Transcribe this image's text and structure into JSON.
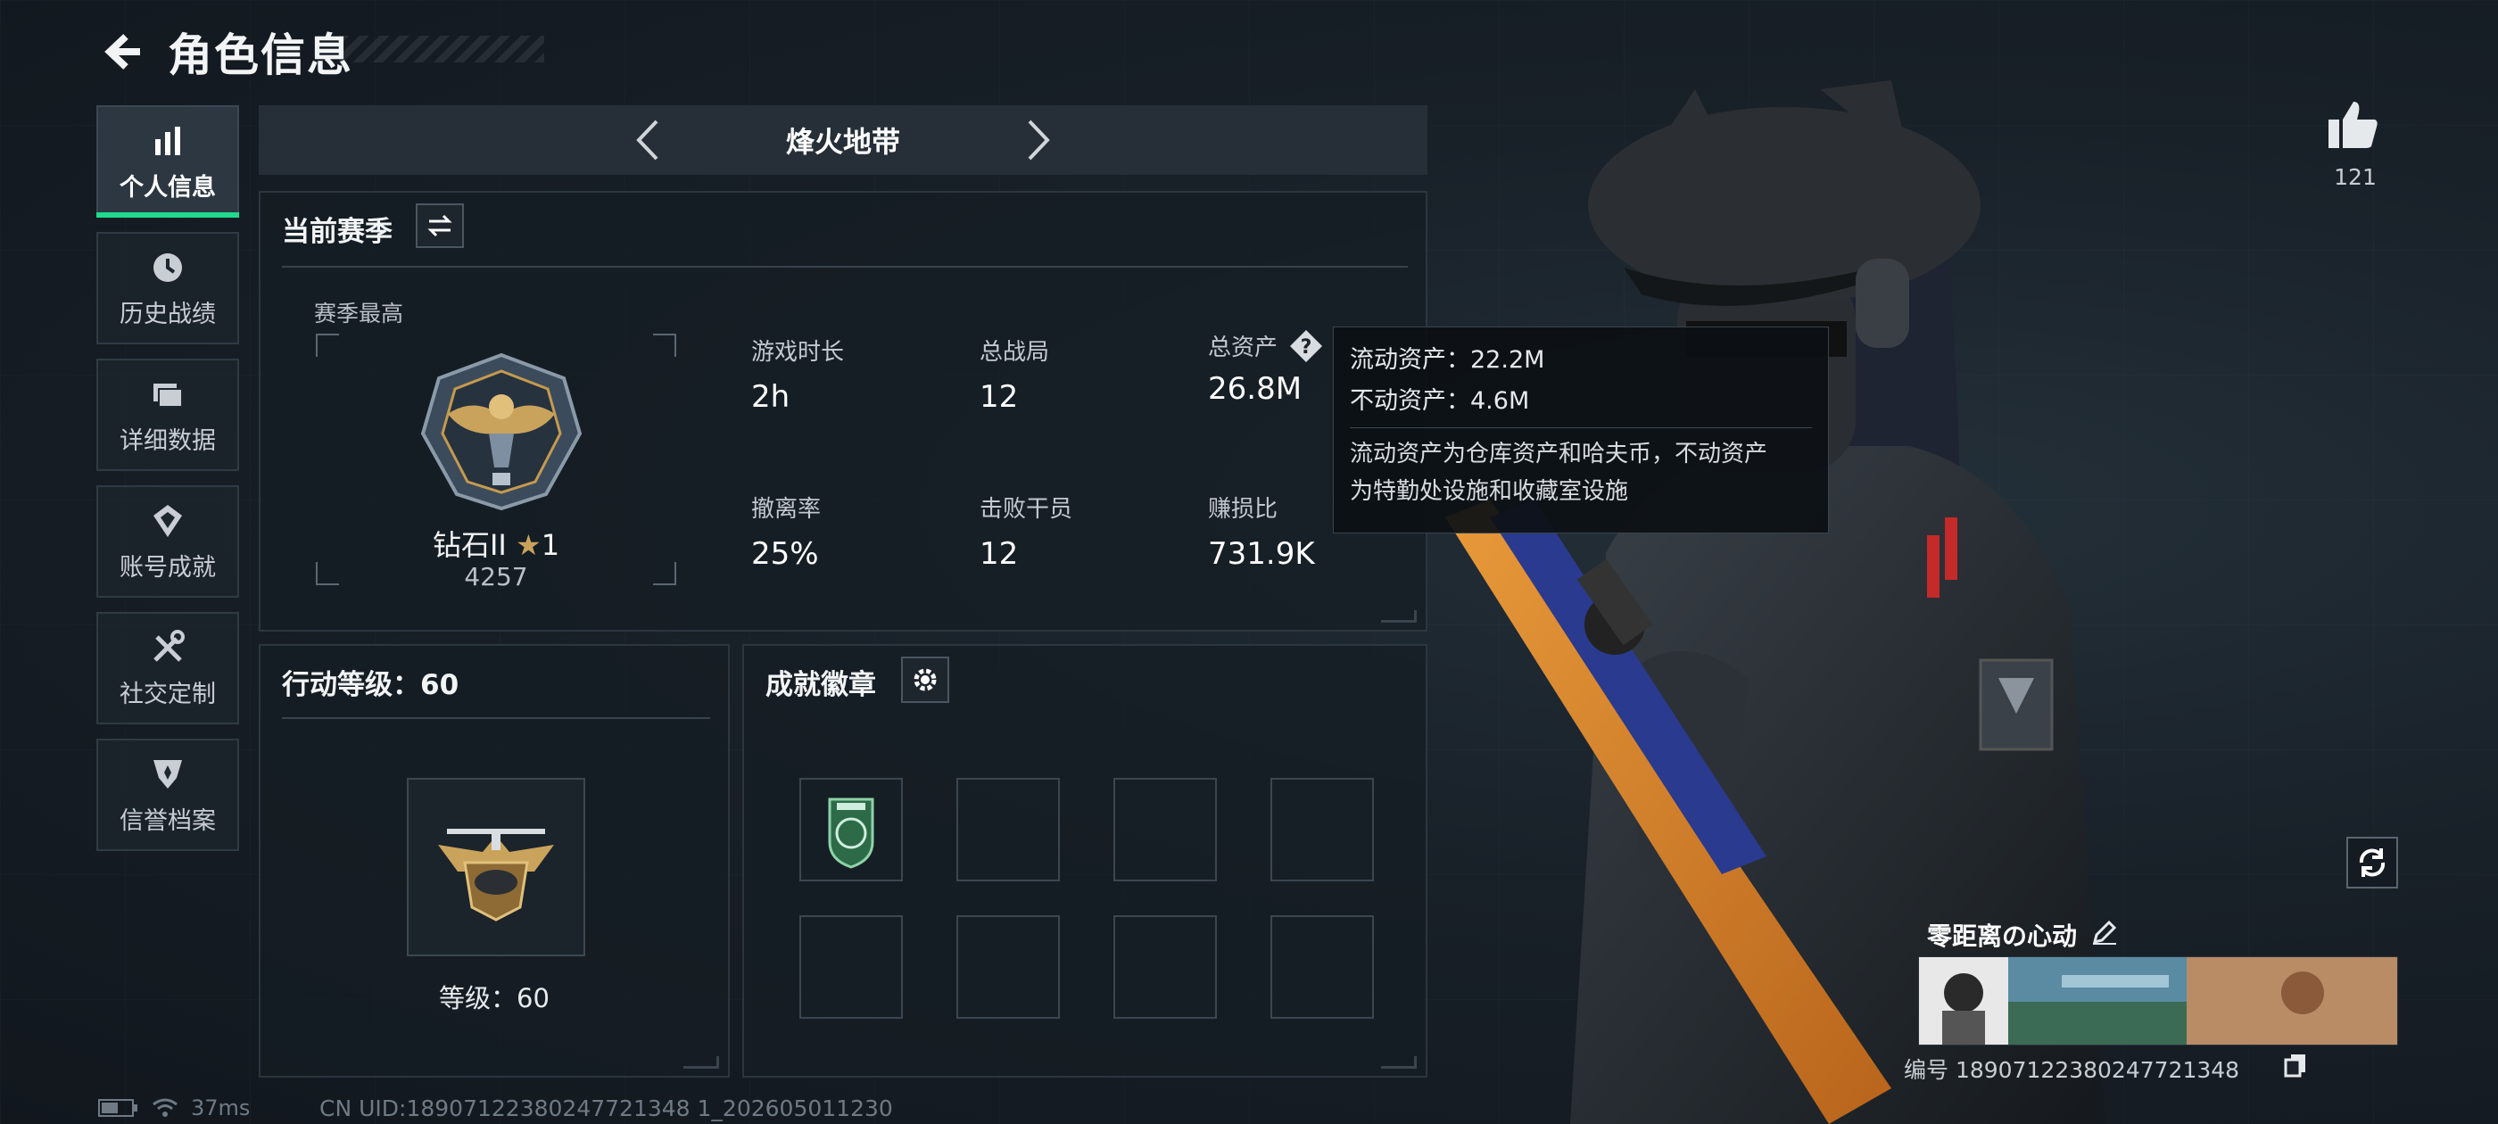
{
  "header": {
    "title": "角色信息"
  },
  "nav": {
    "items": [
      {
        "label": "个人信息",
        "icon": "bar-chart-icon",
        "active": true
      },
      {
        "label": "历史战绩",
        "icon": "clock-icon",
        "active": false
      },
      {
        "label": "详细数据",
        "icon": "folder-icon",
        "active": false
      },
      {
        "label": "账号成就",
        "icon": "achievement-icon",
        "active": false
      },
      {
        "label": "社交定制",
        "icon": "tools-icon",
        "active": false
      },
      {
        "label": "信誉档案",
        "icon": "shield-icon",
        "active": false
      }
    ]
  },
  "mode": {
    "title": "烽火地带"
  },
  "season": {
    "title": "当前赛季",
    "subtitle": "赛季最高",
    "rank_name": "钻石II",
    "rank_stars": "1",
    "rank_score": "4257",
    "stats": [
      {
        "label": "游戏时长",
        "value": "2h"
      },
      {
        "label": "总战局",
        "value": "12"
      },
      {
        "label": "总资产",
        "value": "26.8M"
      },
      {
        "label": "撤离率",
        "value": "25%"
      },
      {
        "label": "击败干员",
        "value": "12"
      },
      {
        "label": "赚损比",
        "value": "731.9K"
      }
    ]
  },
  "tooltip": {
    "liquid": "流动资产：22.2M",
    "fixed": "不动资产：4.6M",
    "desc_line1": "流动资产为仓库资产和哈夫币，不动资产",
    "desc_line2": "为特勤处设施和收藏室设施"
  },
  "level": {
    "title": "行动等级：60",
    "label": "等级：60"
  },
  "badges": {
    "title": "成就徽章"
  },
  "profile": {
    "likes": "121",
    "name": "零距离の心动",
    "id_line": "编号 18907122380247721348"
  },
  "status": {
    "ping": "37ms",
    "uid": "CN UID:18907122380247721348 1_202605011230"
  },
  "colors": {
    "accent": "#20d98d",
    "bg": "#141a21",
    "panel": "#262f38",
    "gold": "#d4a24a"
  }
}
